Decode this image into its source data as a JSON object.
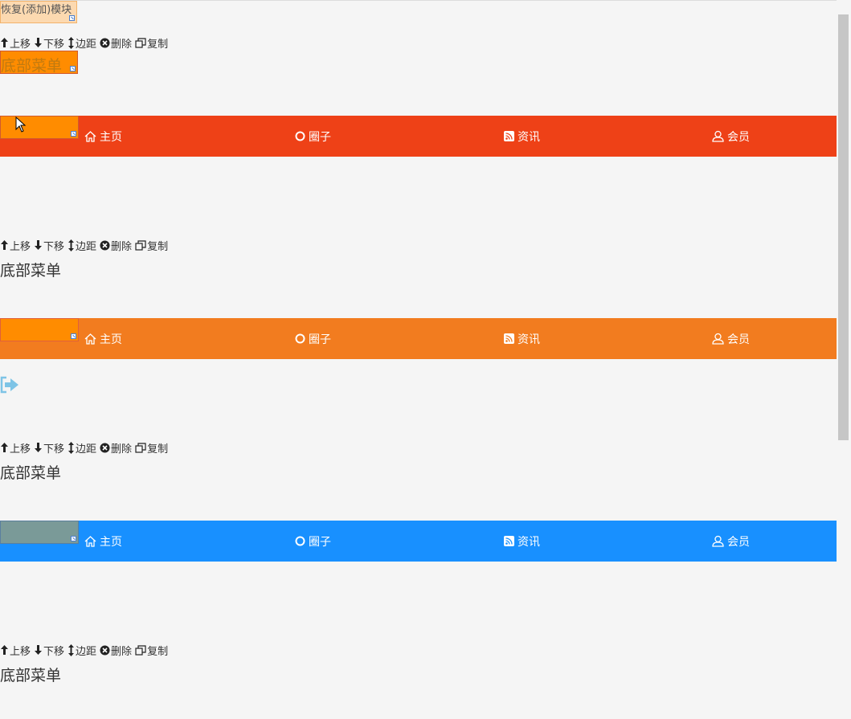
{
  "restore_button_label": "恢复(添加)模块",
  "toolbar": {
    "up": "上移",
    "down": "下移",
    "spacing": "边距",
    "delete": "删除",
    "copy": "复制"
  },
  "modules": [
    {
      "title": "底部菜单",
      "nav_color": "#ee4117",
      "overlay_color": "#ff8c00",
      "nav": [
        "主页",
        "圈子",
        "资讯",
        "会员"
      ]
    },
    {
      "title": "底部菜单",
      "nav_color": "#f27c1f",
      "overlay_color": "#ff8c00",
      "nav": [
        "主页",
        "圈子",
        "资讯",
        "会员"
      ]
    },
    {
      "title": "底部菜单",
      "nav_color": "#1890ff",
      "overlay_color": "#7a9a98",
      "nav": [
        "主页",
        "圈子",
        "资讯",
        "会员"
      ]
    },
    {
      "title": "底部菜单"
    }
  ],
  "nav_icons": [
    "home-icon",
    "circle-icon",
    "rss-icon",
    "user-icon"
  ],
  "colors": {
    "restore_bg": "#fcd9b0",
    "page_bg": "#f5f5f5",
    "exit_icon": "#7ec4e6"
  }
}
